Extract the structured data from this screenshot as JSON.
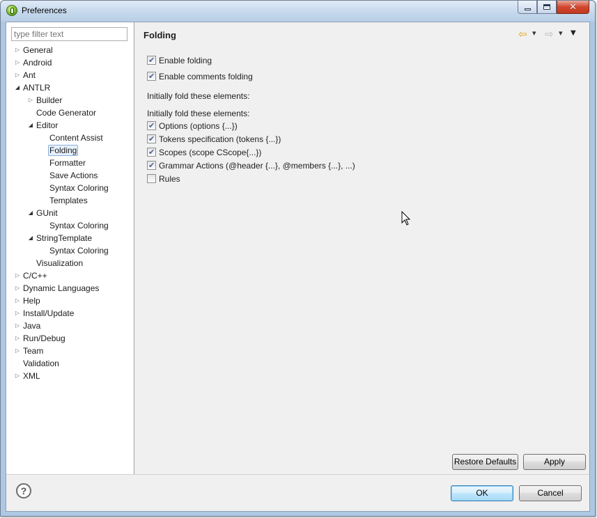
{
  "window": {
    "title": "Preferences",
    "controls": {
      "minimize": "minimize",
      "maximize": "maximize",
      "close": "✕"
    }
  },
  "filter": {
    "placeholder": "type filter text",
    "value": ""
  },
  "tree": {
    "items": [
      {
        "label": "General",
        "level": 0,
        "toggle": "closed"
      },
      {
        "label": "Android",
        "level": 0,
        "toggle": "closed"
      },
      {
        "label": "Ant",
        "level": 0,
        "toggle": "closed"
      },
      {
        "label": "ANTLR",
        "level": 0,
        "toggle": "open"
      },
      {
        "label": "Builder",
        "level": 1,
        "toggle": "closed"
      },
      {
        "label": "Code Generator",
        "level": 1,
        "toggle": "none"
      },
      {
        "label": "Editor",
        "level": 1,
        "toggle": "open"
      },
      {
        "label": "Content Assist",
        "level": 2,
        "toggle": "none"
      },
      {
        "label": "Folding",
        "level": 2,
        "toggle": "none",
        "selected": true
      },
      {
        "label": "Formatter",
        "level": 2,
        "toggle": "none"
      },
      {
        "label": "Save Actions",
        "level": 2,
        "toggle": "none"
      },
      {
        "label": "Syntax Coloring",
        "level": 2,
        "toggle": "none"
      },
      {
        "label": "Templates",
        "level": 2,
        "toggle": "none"
      },
      {
        "label": "GUnit",
        "level": 1,
        "toggle": "open"
      },
      {
        "label": "Syntax Coloring",
        "level": 2,
        "toggle": "none"
      },
      {
        "label": "StringTemplate",
        "level": 1,
        "toggle": "open"
      },
      {
        "label": "Syntax Coloring",
        "level": 2,
        "toggle": "none"
      },
      {
        "label": "Visualization",
        "level": 1,
        "toggle": "none"
      },
      {
        "label": "C/C++",
        "level": 0,
        "toggle": "closed"
      },
      {
        "label": "Dynamic Languages",
        "level": 0,
        "toggle": "closed"
      },
      {
        "label": "Help",
        "level": 0,
        "toggle": "closed"
      },
      {
        "label": "Install/Update",
        "level": 0,
        "toggle": "closed"
      },
      {
        "label": "Java",
        "level": 0,
        "toggle": "closed"
      },
      {
        "label": "Run/Debug",
        "level": 0,
        "toggle": "closed"
      },
      {
        "label": "Team",
        "level": 0,
        "toggle": "closed"
      },
      {
        "label": "Validation",
        "level": 0,
        "toggle": "none"
      },
      {
        "label": "XML",
        "level": 0,
        "toggle": "closed"
      }
    ]
  },
  "page": {
    "title": "Folding",
    "nav": {
      "back": "⇦",
      "back_menu": "▾",
      "forward": "⇨",
      "forward_menu": "▾",
      "view_menu": "▼"
    },
    "options": [
      {
        "label": "Enable folding",
        "checked": true
      },
      {
        "label": "Enable comments folding",
        "checked": true
      }
    ],
    "heading1": "Initially fold these elements:",
    "heading2": "Initially fold these elements:",
    "elements": [
      {
        "label": "Options (options {...})",
        "checked": true
      },
      {
        "label": "Tokens specification (tokens {...})",
        "checked": true
      },
      {
        "label": "Scopes (scope CScope{...})",
        "checked": true
      },
      {
        "label": "Grammar Actions (@header {...}, @members {...}, ...)",
        "checked": true
      },
      {
        "label": "Rules",
        "checked": false
      }
    ],
    "restore_defaults": "Restore Defaults",
    "apply": "Apply"
  },
  "footer": {
    "help": "?",
    "ok": "OK",
    "cancel": "Cancel"
  }
}
